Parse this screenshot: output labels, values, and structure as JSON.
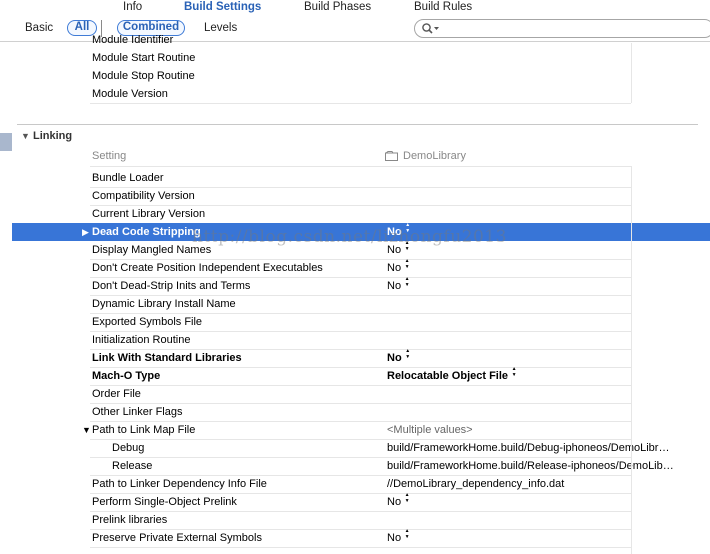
{
  "tabs": [
    {
      "label": "Info",
      "active": false
    },
    {
      "label": "Build Settings",
      "active": true
    },
    {
      "label": "Build Phases",
      "active": false
    },
    {
      "label": "Build Rules",
      "active": false
    }
  ],
  "filter": {
    "basic": "Basic",
    "all": "All",
    "combined": "Combined",
    "levels": "Levels",
    "search_value": ""
  },
  "top_rows": [
    {
      "name": "Module Identifier"
    },
    {
      "name": "Module Start Routine"
    },
    {
      "name": "Module Stop Routine"
    },
    {
      "name": "Module Version"
    }
  ],
  "section": {
    "title": "Linking",
    "column_setting": "Setting",
    "column_target": "DemoLibrary"
  },
  "rows": [
    {
      "name": "Bundle Loader",
      "value": ""
    },
    {
      "name": "Compatibility Version",
      "value": ""
    },
    {
      "name": "Current Library Version",
      "value": ""
    },
    {
      "name": "Dead Code Stripping",
      "value": "No",
      "selected": true,
      "bold": true,
      "disclosure": "▶",
      "stepper": true
    },
    {
      "name": "Display Mangled Names",
      "value": "No",
      "stepper": true
    },
    {
      "name": "Don't Create Position Independent Executables",
      "value": "No",
      "stepper": true
    },
    {
      "name": "Don't Dead-Strip Inits and Terms",
      "value": "No",
      "stepper": true
    },
    {
      "name": "Dynamic Library Install Name",
      "value": ""
    },
    {
      "name": "Exported Symbols File",
      "value": ""
    },
    {
      "name": "Initialization Routine",
      "value": ""
    },
    {
      "name": "Link With Standard Libraries",
      "value": "No",
      "bold": true,
      "stepper": true
    },
    {
      "name": "Mach-O Type",
      "value": "Relocatable Object File",
      "bold": true,
      "stepper": true
    },
    {
      "name": "Order File",
      "value": ""
    },
    {
      "name": "Other Linker Flags",
      "value": ""
    },
    {
      "name": "Path to Link Map File",
      "value": "<Multiple values>",
      "disclosure": "▼",
      "multi": true
    },
    {
      "name": "Debug",
      "value": "build/FrameworkHome.build/Debug-iphoneos/DemoLibr…",
      "indent": true
    },
    {
      "name": "Release",
      "value": "build/FrameworkHome.build/Release-iphoneos/DemoLib…",
      "indent": true
    },
    {
      "name": "Path to Linker Dependency Info File",
      "value": "//DemoLibrary_dependency_info.dat"
    },
    {
      "name": "Perform Single-Object Prelink",
      "value": "No",
      "stepper": true
    },
    {
      "name": "Prelink libraries",
      "value": ""
    },
    {
      "name": "Preserve Private External Symbols",
      "value": "No",
      "stepper": true
    }
  ],
  "watermark": "http://blog.csdn.net/lizhongfu2013",
  "colors": {
    "accent": "#2a62b6",
    "selection": "#3875d7"
  }
}
